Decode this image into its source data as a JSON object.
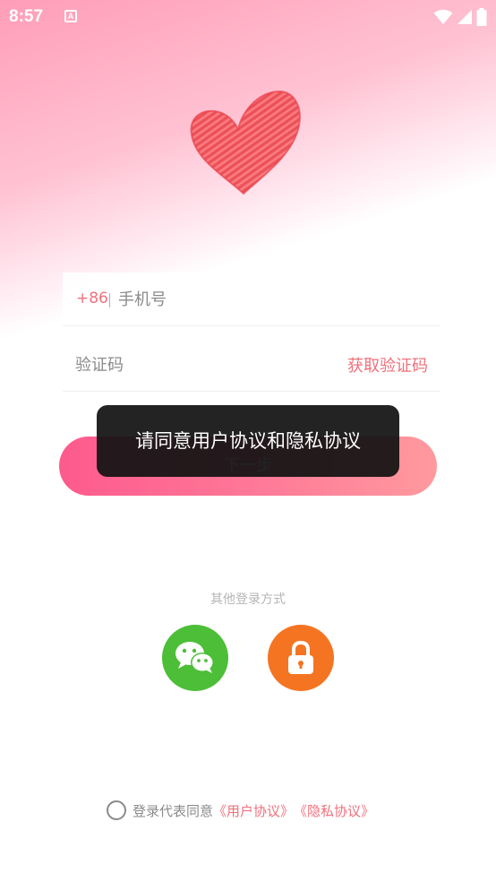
{
  "status_bar": {
    "time": "8:57",
    "notification_icon": "a-box-icon",
    "wifi_icon": "wifi-icon",
    "signal_icon": "signal-icon",
    "battery_icon": "battery-icon"
  },
  "hero": {
    "icon": "heart-icon",
    "color": "#f04c56"
  },
  "form": {
    "country_code": "+86",
    "phone_placeholder": "手机号",
    "code_placeholder": "验证码",
    "get_code_label": "获取验证码"
  },
  "next_button": {
    "label": "下一步"
  },
  "toast": {
    "message": "请同意用户协议和隐私协议"
  },
  "other_login": {
    "title": "其他登录方式",
    "methods": [
      {
        "icon": "wechat-icon",
        "color": "#4cbe37"
      },
      {
        "icon": "lock-icon",
        "color": "#f57422"
      }
    ]
  },
  "agreement": {
    "prefix": "登录代表同意",
    "user_agreement": "《用户协议》",
    "privacy_agreement": "《隐私协议》"
  },
  "colors": {
    "accent": "#f0707c",
    "button_start": "#fd5a8d",
    "button_end": "#ff9a9e"
  }
}
